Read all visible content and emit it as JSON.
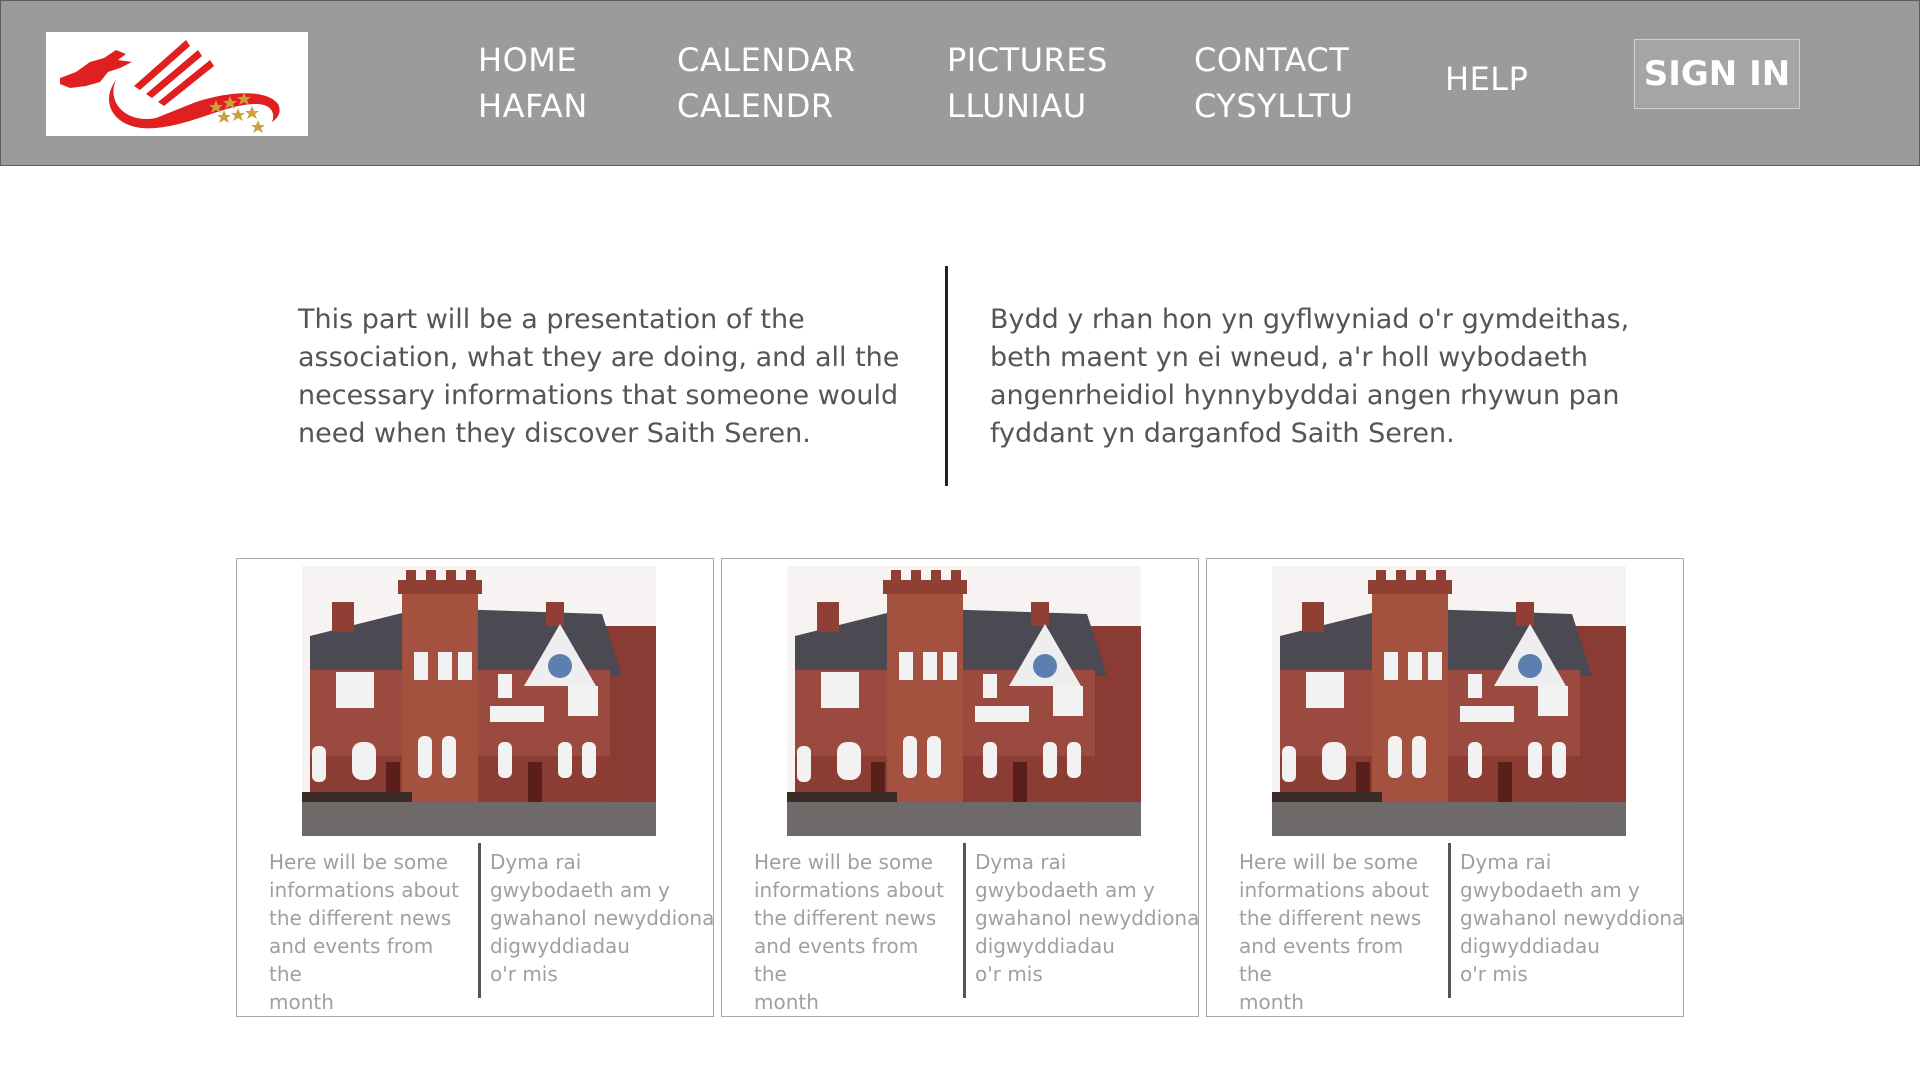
{
  "header": {
    "logo_icon": "dragon-logo-icon",
    "nav": [
      {
        "en": "HOME",
        "cy": "HAFAN"
      },
      {
        "en": "CALENDAR",
        "cy": "CALENDR"
      },
      {
        "en": "PICTURES",
        "cy": "LLUNIAU"
      },
      {
        "en": "CONTACT",
        "cy": "CYSYLLTU"
      }
    ],
    "help_label": "HELP",
    "signin_label": "SIGN IN"
  },
  "intro": {
    "en": "This part will be a presentation of the association, what they are doing, and all the necessary informations that someone would need when they discover Saith Seren.",
    "cy": "Bydd y rhan hon yn gyflwyniad o'r gymdeithas, beth maent yn ei wneud, a'r holl wybodaeth angenrheidiol hynnybyddai angen rhywun pan fyddant yn darganfod Saith Seren."
  },
  "cards": [
    {
      "en_lines": [
        "Here will be some",
        "informations about",
        "the different news",
        "and events from the",
        "month"
      ],
      "cy_lines": [
        "Dyma rai",
        "gwybodaeth am y",
        "gwahanol newyddiona",
        "digwyddiadau",
        "o'r mis"
      ]
    },
    {
      "en_lines": [
        "Here will be some",
        "informations about",
        "the different news",
        "and events from the",
        "month"
      ],
      "cy_lines": [
        "Dyma rai",
        "gwybodaeth am y",
        "gwahanol newyddiona",
        "digwyddiadau",
        "o'r mis"
      ]
    },
    {
      "en_lines": [
        "Here will be some",
        "informations about",
        "the different news",
        "and events from the",
        "month"
      ],
      "cy_lines": [
        "Dyma rai",
        "gwybodaeth am y",
        "gwahanol newyddiona",
        "digwyddiadau",
        "o'r mis"
      ]
    }
  ],
  "colors": {
    "header_bg": "#9c9b9c",
    "nav_text": "#ffffff",
    "brand_red": "#e02020",
    "star_gold": "#c9a23a"
  }
}
